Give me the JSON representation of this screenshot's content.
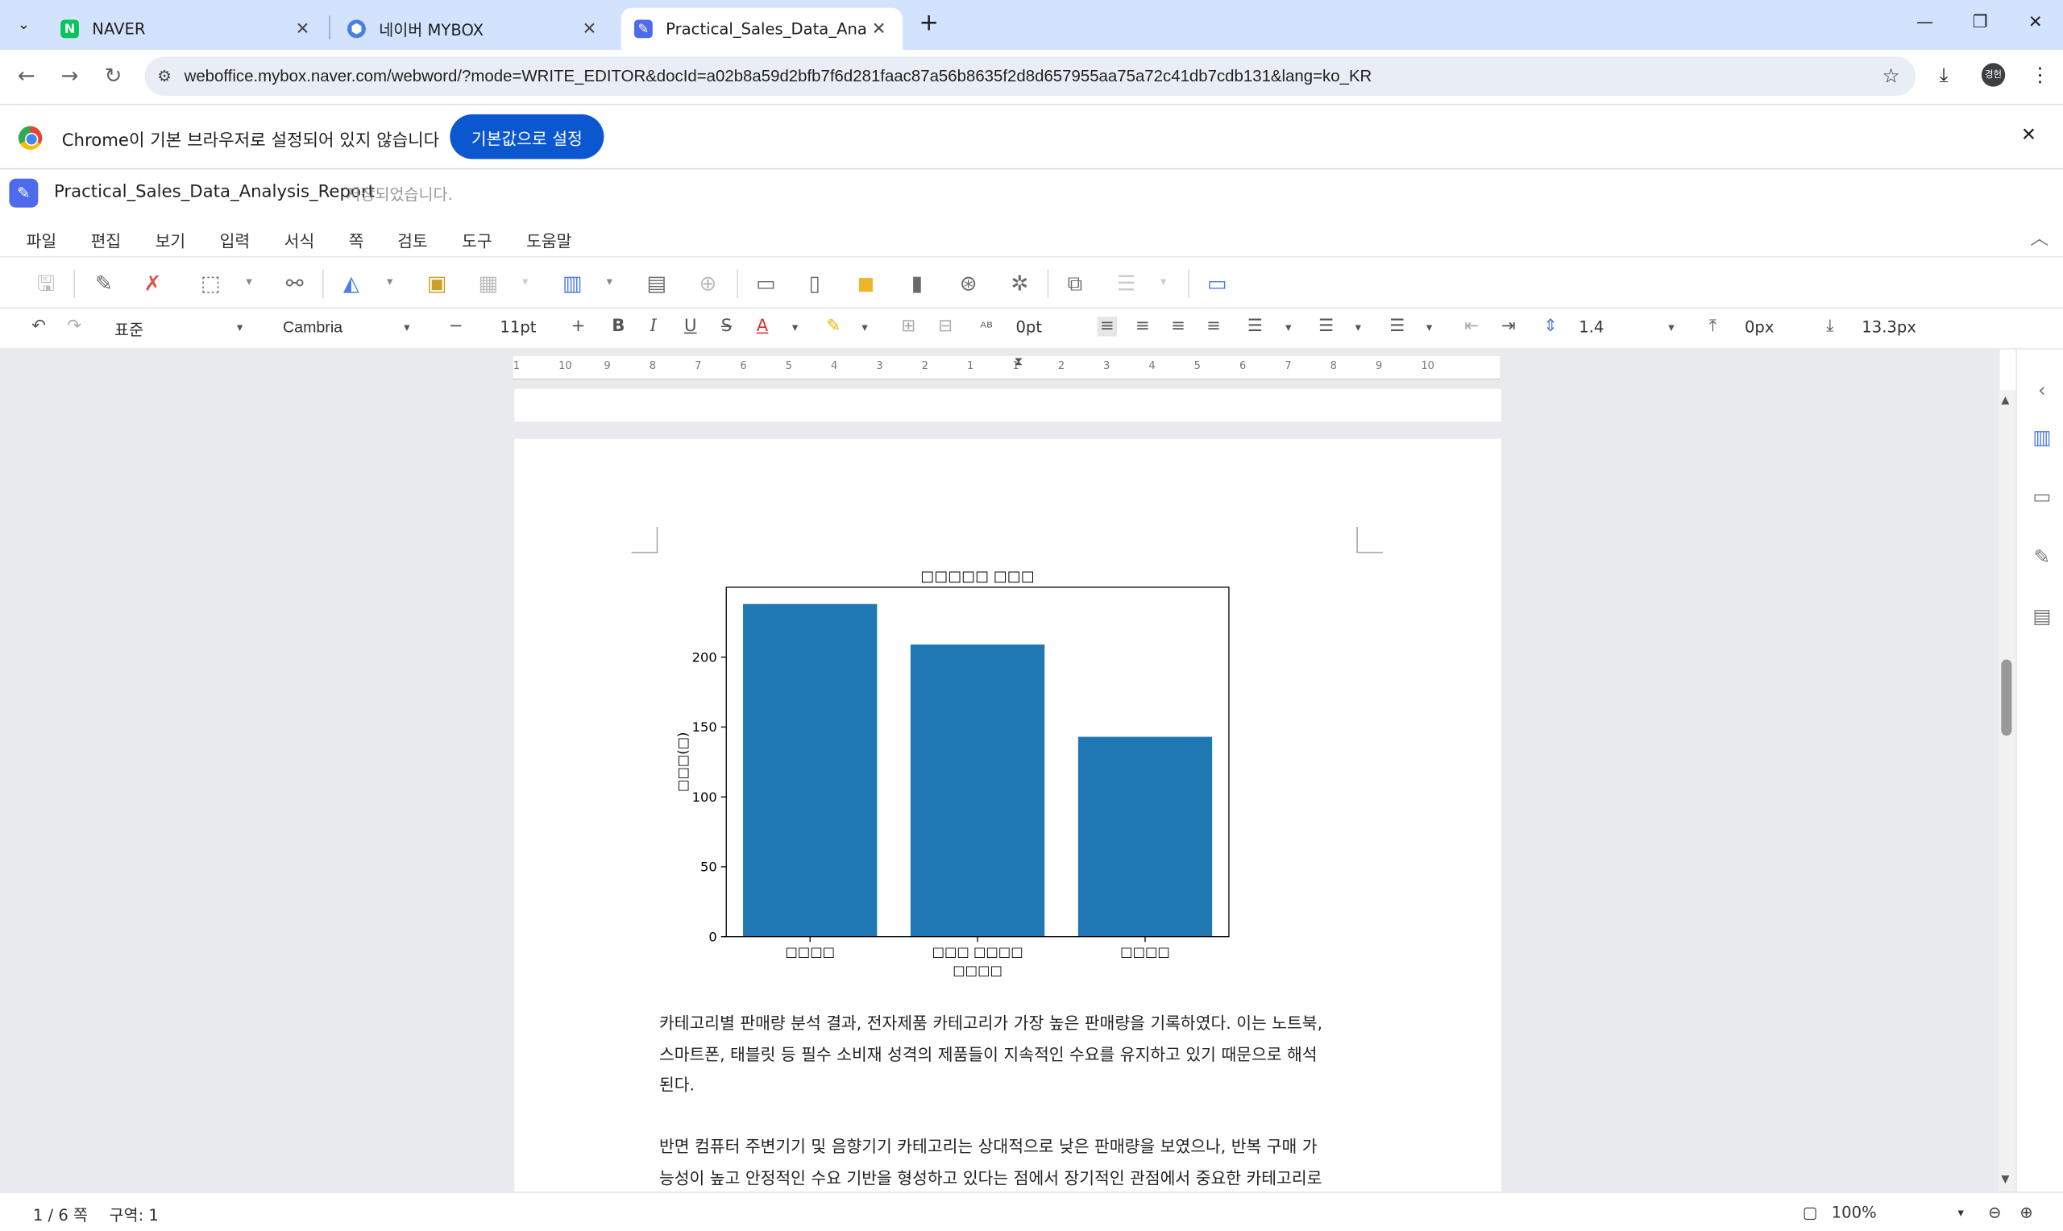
{
  "browser": {
    "tabs": [
      {
        "title": "NAVER",
        "favicon": "N",
        "favicon_color": "#03c75a"
      },
      {
        "title": "네이버 MYBOX",
        "favicon": "⬢",
        "favicon_color": "#4a7de8"
      },
      {
        "title": "Practical_Sales_Data_Analysis_R",
        "favicon": "✎",
        "favicon_color": "#4f6bed"
      }
    ],
    "url": "weboffice.mybox.naver.com/webword/?mode=WRITE_EDITOR&docId=a02b8a59d2bfb7f6d281faac87a56b8635f2d8d657955aa75a72c41db7cdb131&lang=ko_KR",
    "avatar_text": "경헌"
  },
  "infobar": {
    "message": "Chrome이 기본 브라우저로 설정되어 있지 않습니다",
    "button": "기본값으로 설정"
  },
  "app": {
    "doc_title": "Practical_Sales_Data_Analysis_Report",
    "save_status": "저장되었습니다.",
    "menu": [
      "파일",
      "편집",
      "보기",
      "입력",
      "서식",
      "쪽",
      "검토",
      "도구",
      "도움말"
    ]
  },
  "format": {
    "style": "표준",
    "font": "Cambria",
    "size": "11pt",
    "char_spacing": "0pt",
    "line_spacing": "1.4",
    "space_before": "0px",
    "space_after": "13.3px"
  },
  "ruler": {
    "labels": [
      "1",
      "10",
      "9",
      "8",
      "7",
      "6",
      "5",
      "4",
      "3",
      "2",
      "1",
      "1",
      "2",
      "3",
      "4",
      "5",
      "6",
      "7",
      "8",
      "9",
      "10"
    ]
  },
  "chart_data": {
    "type": "bar",
    "title": "□□□□□ □□□",
    "categories": [
      "□□□□",
      "□□□ □□□□",
      "□□□□"
    ],
    "values": [
      238,
      209,
      143
    ],
    "xlabel": "□□□□",
    "ylabel": "□□□(□)",
    "ylim": [
      0,
      250
    ],
    "yticks": [
      0,
      50,
      100,
      150,
      200
    ],
    "bar_color": "#1f77b4"
  },
  "document": {
    "paragraph1": [
      "카테고리별 판매량 분석 결과, 전자제품 카테고리가 가장 높은 판매량을 기록하였다. 이는 노트북,",
      "스마트폰, 태블릿 등 필수 소비재 성격의 제품들이 지속적인 수요를 유지하고 있기 때문으로 해석",
      "된다."
    ],
    "paragraph2": [
      "반면 컴퓨터 주변기기 및 음향기기 카테고리는 상대적으로 낮은 판매량을 보였으나, 반복 구매 가",
      "능성이 높고 안정적인 수요 기반을 형성하고 있다는 점에서 장기적인 관점에서 중요한 카테고리로"
    ]
  },
  "status": {
    "page": "1 / 6 쪽",
    "section": "구역: 1",
    "zoom": "100%"
  }
}
